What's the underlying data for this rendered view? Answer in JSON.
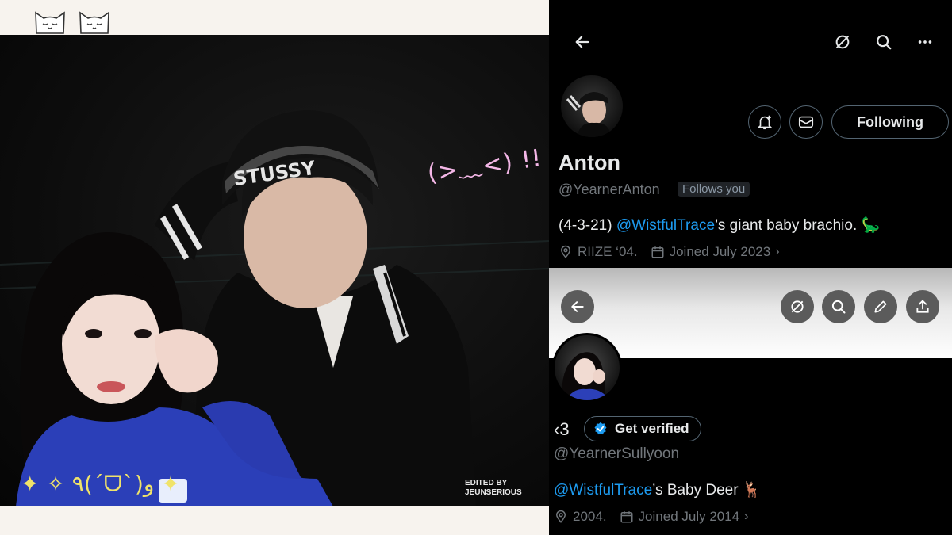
{
  "photo": {
    "kaomoji": "(>﹏<) !!",
    "credit_line1": "EDITED BY",
    "credit_line2": "JEUNSERIOUS",
    "cap_text": "STUSSY",
    "sparkle_text": "✦ ✧ ٩(ˊᗜˋ)و ✦"
  },
  "profile1": {
    "name": "Anton",
    "handle": "@YearnerAnton",
    "follows_you": "Follows you",
    "bio_prefix": "(4-3-21) ",
    "bio_mention": "@WistfulTrace",
    "bio_suffix": "’s giant baby brachio. 🦕",
    "location": "RIIZE ‘04.",
    "joined": "Joined July 2023",
    "following_label": "Following"
  },
  "profile2": {
    "name": "‹3",
    "get_verified": "Get verified",
    "handle": "@YearnerSullyoon",
    "bio_mention": "@WistfulTrace",
    "bio_suffix": "’s Baby Deer 🦌",
    "location": "2004.",
    "joined": "Joined July 2014"
  },
  "colors": {
    "accent": "#1d9bf0",
    "muted": "#71767b",
    "kaomoji": "#f3b6e6"
  },
  "icons": [
    "back-arrow-icon",
    "grok-icon",
    "search-icon",
    "more-icon",
    "bell-plus-icon",
    "mail-icon",
    "location-icon",
    "calendar-icon",
    "edit-icon",
    "share-icon",
    "verified-badge-icon",
    "cat-face-icon"
  ]
}
